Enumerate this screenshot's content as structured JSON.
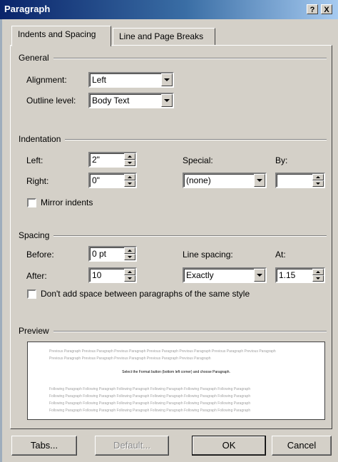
{
  "dialog": {
    "title": "Paragraph",
    "help_label": "?",
    "close_label": "X"
  },
  "tabs": [
    {
      "label": "Indents and Spacing",
      "active": true
    },
    {
      "label": "Line and Page Breaks",
      "active": false
    }
  ],
  "general": {
    "group_label": "General",
    "alignment_label": "Alignment:",
    "alignment_value": "Left",
    "outline_label": "Outline level:",
    "outline_value": "Body Text"
  },
  "indentation": {
    "group_label": "Indentation",
    "left_label": "Left:",
    "left_value": "2\"",
    "right_label": "Right:",
    "right_value": "0\"",
    "special_label": "Special:",
    "special_value": "(none)",
    "by_label": "By:",
    "by_value": "",
    "mirror_label": "Mirror indents",
    "mirror_checked": false
  },
  "spacing": {
    "group_label": "Spacing",
    "before_label": "Before:",
    "before_value": "0 pt",
    "after_label": "After:",
    "after_value": "10",
    "line_spacing_label": "Line spacing:",
    "line_spacing_value": "Exactly",
    "at_label": "At:",
    "at_value": "1.15",
    "dont_add_label": "Don't add space between paragraphs of the same style",
    "dont_add_checked": false
  },
  "preview": {
    "group_label": "Preview",
    "prev_1": "Previous Paragraph Previous Paragraph Previous Paragraph Previous Paragraph Previous Paragraph Previous Paragraph Previous Paragraph",
    "prev_2": "Previous Paragraph Previous Paragraph Previous Paragraph Previous Paragraph Previous Paragraph",
    "sample": "Select the Format button (bottom left corner) and choose Paragraph.",
    "follow_1": "Following Paragraph Following Paragraph Following Paragraph Following Paragraph Following Paragraph Following Paragraph",
    "follow_2": "Following Paragraph Following Paragraph Following Paragraph Following Paragraph Following Paragraph Following Paragraph",
    "follow_3": "Following Paragraph Following Paragraph Following Paragraph Following Paragraph Following Paragraph Following Paragraph",
    "follow_4": "Following Paragraph Following Paragraph Following Paragraph Following Paragraph Following Paragraph Following Paragraph"
  },
  "buttons": {
    "tabs": "Tabs...",
    "default": "Default...",
    "ok": "OK",
    "cancel": "Cancel"
  }
}
